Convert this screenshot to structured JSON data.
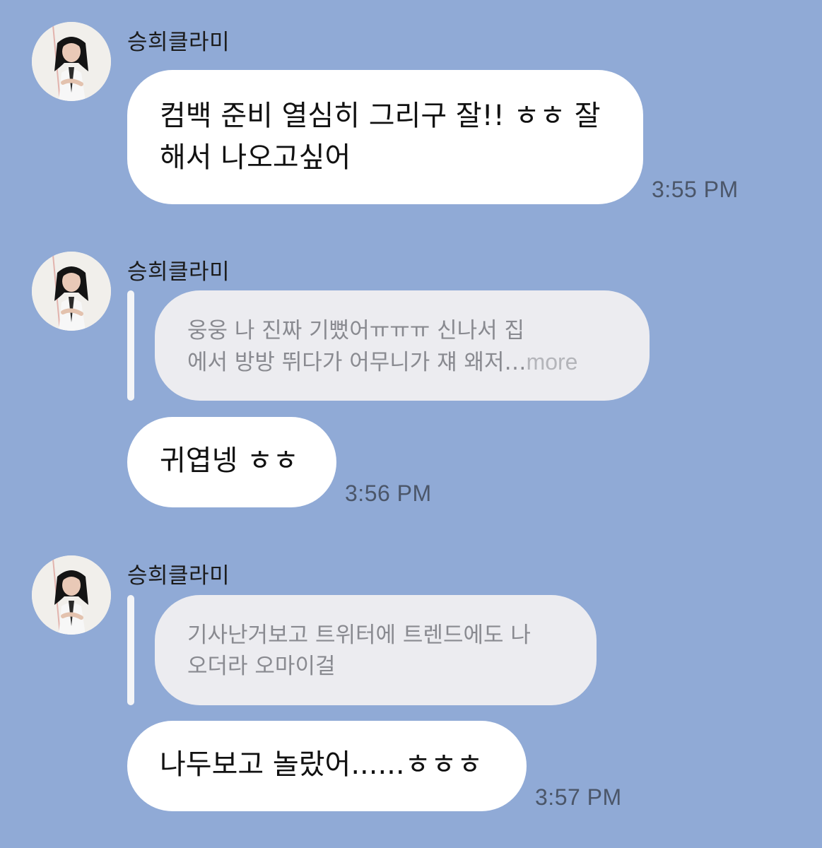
{
  "messages": [
    {
      "sender": "승희클라미",
      "text": "컴백 준비 열심히 그리구 잘!! ㅎㅎ 잘\n해서 나오고싶어",
      "time": "3:55 PM"
    },
    {
      "sender": "승희클라미",
      "quote": "웅웅 나 진짜 기뻤어ㅠㅠㅠ 신나서 집\n에서 방방 뛰다가 어무니가 쟤 왜저…",
      "quote_more": "more",
      "text": "귀엽넹 ㅎㅎ",
      "time": "3:56 PM"
    },
    {
      "sender": "승희클라미",
      "quote": "기사난거보고 트위터에 트렌드에도 나\n오더라 오마이걸",
      "text": "나두보고 놀랐어......ㅎㅎㅎ",
      "time": "3:57 PM"
    }
  ]
}
